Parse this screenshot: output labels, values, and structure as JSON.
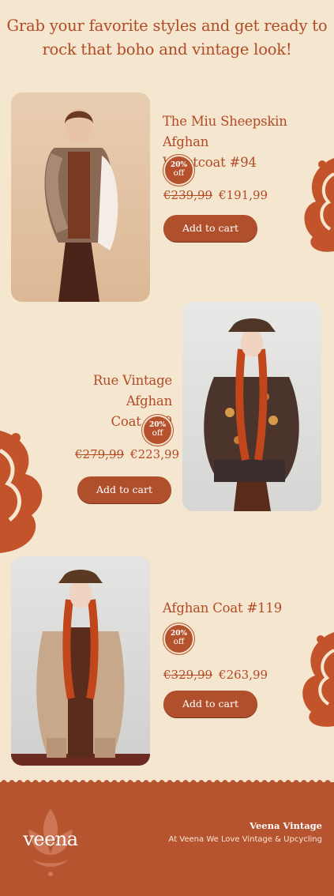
{
  "headline": {
    "line1": "Grab your favorite styles and get ready to",
    "line2": "rock that boho and vintage look!"
  },
  "products": [
    {
      "title_line1": "The Miu Sheepskin Afghan",
      "title_line2": "Waistcoat #94",
      "badge_pct": "20%",
      "badge_off": "off",
      "old_price": "€239,99",
      "new_price": "€191,99",
      "button": "Add to cart",
      "image_icon": "waistcoat-photo"
    },
    {
      "title_line1": "Rue Vintage Afghan",
      "title_line2": "Coat #60",
      "badge_pct": "20%",
      "badge_off": "off",
      "old_price": "€279,99",
      "new_price": "€223,99",
      "button": "Add to cart",
      "image_icon": "embroidered-coat-photo"
    },
    {
      "title_line1": "Afghan Coat #119",
      "title_line2": "",
      "badge_pct": "20%",
      "badge_off": "off",
      "old_price": "€329,99",
      "new_price": "€263,99",
      "button": "Add to cart",
      "image_icon": "long-coat-photo"
    }
  ],
  "footer": {
    "logo": "veena",
    "brand_name": "Veena Vintage",
    "tagline": "At Veena We Love Vintage & Upcycling"
  },
  "colors": {
    "background": "#f4e6cf",
    "accent": "#b5542f",
    "text": "#b34a24"
  }
}
